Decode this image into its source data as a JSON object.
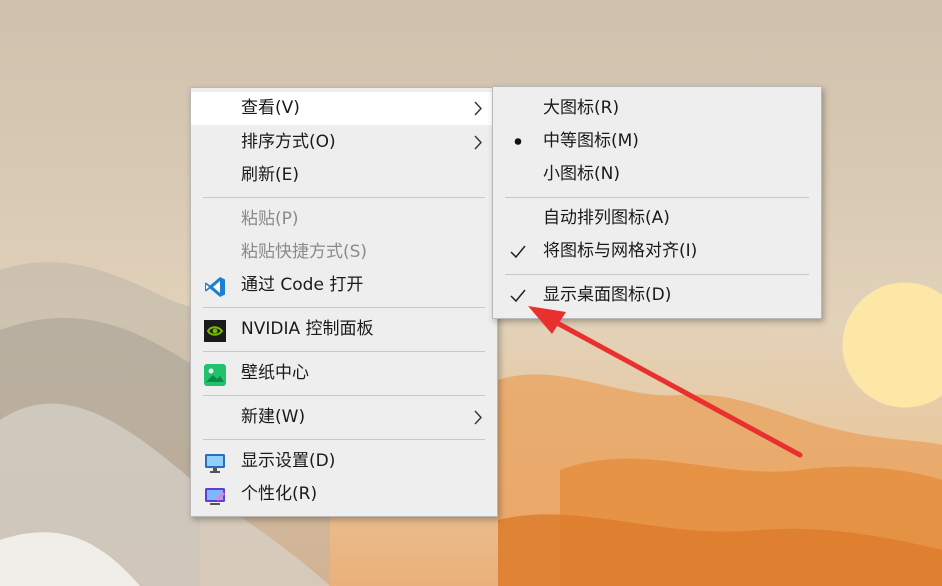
{
  "main_menu": {
    "view": "查看(V)",
    "sort_by": "排序方式(O)",
    "refresh": "刷新(E)",
    "paste": "粘贴(P)",
    "paste_shortcut": "粘贴快捷方式(S)",
    "open_with_code": "通过 Code 打开",
    "nvidia_panel": "NVIDIA 控制面板",
    "wallpaper_center": "壁纸中心",
    "new": "新建(W)",
    "display_settings": "显示设置(D)",
    "personalize": "个性化(R)"
  },
  "view_submenu": {
    "large_icons": "大图标(R)",
    "medium_icons": "中等图标(M)",
    "small_icons": "小图标(N)",
    "auto_arrange": "自动排列图标(A)",
    "align_to_grid": "将图标与网格对齐(I)",
    "show_desktop_icons": "显示桌面图标(D)",
    "selected_size": "中等图标(M)",
    "checked_items": [
      "将图标与网格对齐(I)",
      "显示桌面图标(D)"
    ]
  },
  "icons": {
    "submenu_arrow": "chevron-right-icon",
    "radio": "bullet-icon",
    "check": "checkmark-icon",
    "vscode": "vscode-icon",
    "nvidia": "nvidia-icon",
    "wallpaper": "wallpaper-icon",
    "display": "monitor-icon",
    "personalize": "personalize-icon"
  },
  "colors": {
    "menu_bg": "#eeeeee",
    "hover_bg": "#ffffff",
    "annotation_arrow": "#e8312f"
  }
}
